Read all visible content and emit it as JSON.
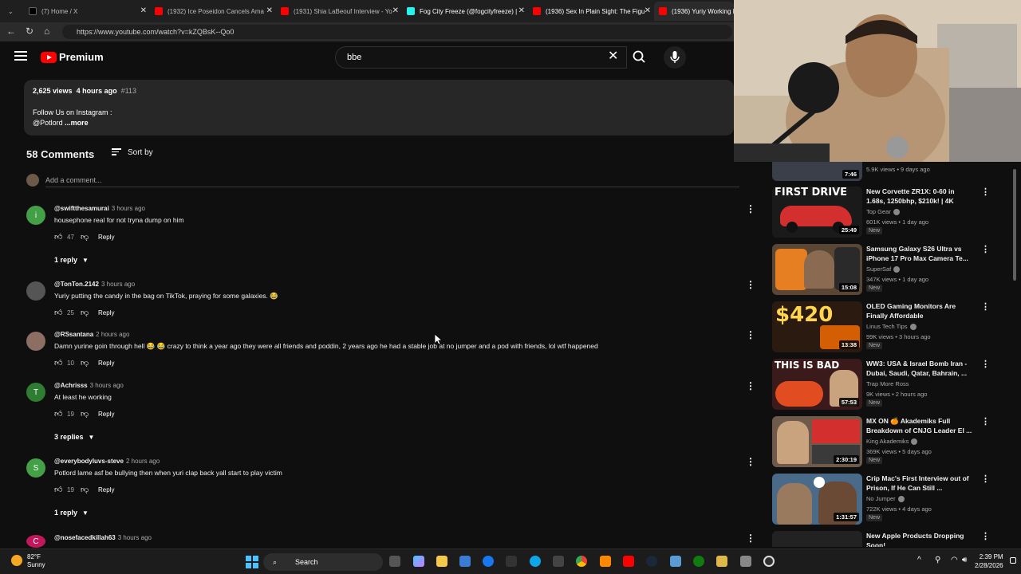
{
  "browser": {
    "tabs": [
      {
        "label": "(7) Home / X",
        "color": "#000000"
      },
      {
        "label": "(1932) Ice Poseidon Cancels Ama",
        "color": "#ff0000"
      },
      {
        "label": "(1931) Shia LaBeouf Interview - Yo",
        "color": "#ff0000"
      },
      {
        "label": "Fog City Freeze (@fogcityfreeze) |",
        "color": "#25f4ee"
      },
      {
        "label": "(1936) Sex In Plain Sight: The Figu",
        "color": "#ff0000"
      },
      {
        "label": "(1936) Yuriy Working I",
        "color": "#ff0000"
      }
    ],
    "url": "https://www.youtube.com/watch?v=kZQBsK--Qo0"
  },
  "youtube": {
    "brand": "Premium",
    "search_value": "bbe"
  },
  "description": {
    "views": "2,625 views",
    "age": "4 hours ago",
    "tag": "#113",
    "line1": "Follow Us on Instagram :",
    "line2": "@Potlord",
    "more": "...more"
  },
  "comments_section": {
    "count_label": "58 Comments",
    "sort_label": "Sort by",
    "add_placeholder": "Add a comment...",
    "comments": [
      {
        "author": "@swiftthesamurai",
        "time": "3 hours ago",
        "text": "housephone real for not tryna dump on him",
        "likes": "47",
        "reply_label": "Reply",
        "replies_label": "1 reply",
        "avatar_letter": "i",
        "avatar_color": "#43a047"
      },
      {
        "author": "@TonTon.2142",
        "time": "3 hours ago",
        "text": "Yuriy putting the candy in the bag on TikTok, praying for some galaxies. 😂",
        "likes": "25",
        "reply_label": "Reply",
        "replies_label": "",
        "avatar_letter": "",
        "avatar_color": "#555555"
      },
      {
        "author": "@RSsantana",
        "time": "2 hours ago",
        "text": "Damn yurine goin through hell 😂 😂 crazy to think a year ago they were all friends and poddin, 2 years ago he had a stable job at no jumper and a pod with friends, lol wtf happened",
        "likes": "10",
        "reply_label": "Reply",
        "replies_label": "",
        "avatar_letter": "",
        "avatar_color": "#8d6e63"
      },
      {
        "author": "@Achrisss",
        "time": "3 hours ago",
        "text": "At least he working",
        "likes": "19",
        "reply_label": "Reply",
        "replies_label": "3 replies",
        "avatar_letter": "T",
        "avatar_color": "#2e7d32"
      },
      {
        "author": "@everybodyluvs-steve",
        "time": "2 hours ago",
        "text": "Potlord lame asf be bullying  then when yuri clap back yall start to play victim",
        "likes": "19",
        "reply_label": "Reply",
        "replies_label": "1 reply",
        "avatar_letter": "S",
        "avatar_color": "#43a047"
      },
      {
        "author": "@nosefacedkillah63",
        "time": "3 hours ago",
        "text": "",
        "likes": "",
        "reply_label": "",
        "replies_label": "",
        "avatar_letter": "C",
        "avatar_color": "#c2185b"
      }
    ]
  },
  "sidebar": {
    "partial_top": {
      "duration": "7:46",
      "meta": "5.9K views • 9 days ago"
    },
    "videos": [
      {
        "title": "New Corvette ZR1X: 0-60 in 1.68s, 1250bhp, $210k! | 4K",
        "channel": "Top Gear",
        "meta": "601K views • 1 day ago",
        "badge": "New",
        "duration": "25:49",
        "thumb_text": "FIRST DRIVE",
        "thumb_bg": "#1a1a1a",
        "thumb_fg": "#ffffff",
        "accent": "#d32f2f"
      },
      {
        "title": "Samsung Galaxy S26 Ultra vs iPhone 17 Pro Max Camera Te...",
        "channel": "SuperSaf",
        "meta": "347K views • 1 day ago",
        "badge": "New",
        "duration": "15:08",
        "thumb_text": "",
        "thumb_bg": "#5a4634",
        "thumb_fg": "#ffffff",
        "accent": "#e67e22"
      },
      {
        "title": "OLED Gaming Monitors Are Finally Affordable",
        "channel": "Linus Tech Tips",
        "meta": "99K views • 3 hours ago",
        "badge": "New",
        "duration": "13:38",
        "thumb_text": "$420",
        "thumb_bg": "#2a1a10",
        "thumb_fg": "#ffd54f",
        "accent": "#ff6f00"
      },
      {
        "title": "WW3: USA & Israel Bomb Iran - Dubai, Saudi, Qatar, Bahrain, ...",
        "channel": "Trap More Ross",
        "meta": "9K views • 2 hours ago",
        "badge": "New",
        "duration": "57:53",
        "thumb_text": "THIS IS BAD",
        "thumb_bg": "#3a1a1a",
        "thumb_fg": "#ffffff",
        "accent": "#ff5722"
      },
      {
        "title": "MX ON 🍊 Akademiks Full Breakdown of CNJG Leader El ...",
        "channel": "King Akademiks",
        "meta": "369K views • 5 days ago",
        "badge": "New",
        "duration": "2:30:19",
        "thumb_text": "",
        "thumb_bg": "#6d5a4a",
        "thumb_fg": "#ffffff",
        "accent": "#d32f2f"
      },
      {
        "title": "Crip Mac's First Interview out of Prison, If He Can Still ...",
        "channel": "No Jumper",
        "meta": "722K views • 4 days ago",
        "badge": "New",
        "duration": "1:31:57",
        "thumb_text": "",
        "thumb_bg": "#4a6a8a",
        "thumb_fg": "#ffffff",
        "accent": "#ffffff"
      },
      {
        "title": "New Apple Products Dropping Soon!",
        "channel": "",
        "meta": "",
        "badge": "",
        "duration": "",
        "thumb_text": "",
        "thumb_bg": "#222222",
        "thumb_fg": "#ffffff",
        "accent": "#888888"
      }
    ]
  },
  "taskbar": {
    "temp": "82°F",
    "condition": "Sunny",
    "search_label": "Search",
    "time": "2:39 PM",
    "date": "2/28/2026"
  }
}
